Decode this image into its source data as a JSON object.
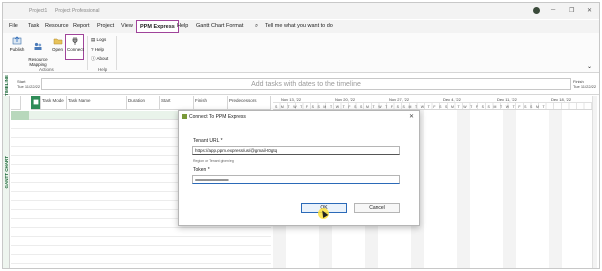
{
  "titlebar": {
    "project": "Project1",
    "app": "Project Professional"
  },
  "menu": {
    "items": [
      "File",
      "Task",
      "Resource",
      "Report",
      "Project",
      "View",
      "PPM Express",
      "Help",
      "Gantt Chart Format"
    ],
    "active": "PPM Express",
    "search": "Tell me what you want to do"
  },
  "ribbon": {
    "buttons": {
      "publish": "Publish",
      "resource_mapping": "Resource\nMapping",
      "open": "Open",
      "connect": "Connect"
    },
    "small": {
      "logs": "Logs",
      "help": "Help",
      "about": "About"
    },
    "groups": {
      "actions": "Actions",
      "help": "Help"
    }
  },
  "timeline": {
    "side_label": "TIMELINE",
    "placeholder": "Add tasks with dates to the timeline",
    "start_label": "Start",
    "start_date": "Tue 11/22/22",
    "finish_label": "Finish",
    "finish_date": "Tue 11/22/22"
  },
  "gantt": {
    "side_label": "GANTT CHART",
    "columns": [
      "Task Mode",
      "Task Name",
      "Duration",
      "Start",
      "Finish",
      "Predecessors"
    ],
    "weeks": [
      "Nov 13, '22",
      "Nov 20, '22",
      "Nov 27, '22",
      "Dec 4, '22",
      "Dec 11, '22",
      "Dec 18, '22"
    ],
    "day_letters": "SMTWTFSSMTWTFSSMTWTFSSMTWTFSSMTWTFSSMTWTFSSMT"
  },
  "dialog": {
    "title": "Connect To PPM Express",
    "tenant_label": "Tenant URL *",
    "tenant_value": "https://app.ppm.express/us/@gmail-t0gtq",
    "tenant_hint": "Region or Tenant given/eg",
    "token_label": "Token *",
    "token_value": "•••••••••••••••••••••••••••••••••••••••••••••••••••••••",
    "ok": "OK",
    "cancel": "Cancel"
  },
  "colors": {
    "highlight": "#a0449a",
    "accent_green": "#2e8b57",
    "focus_blue": "#2b6ab8"
  }
}
